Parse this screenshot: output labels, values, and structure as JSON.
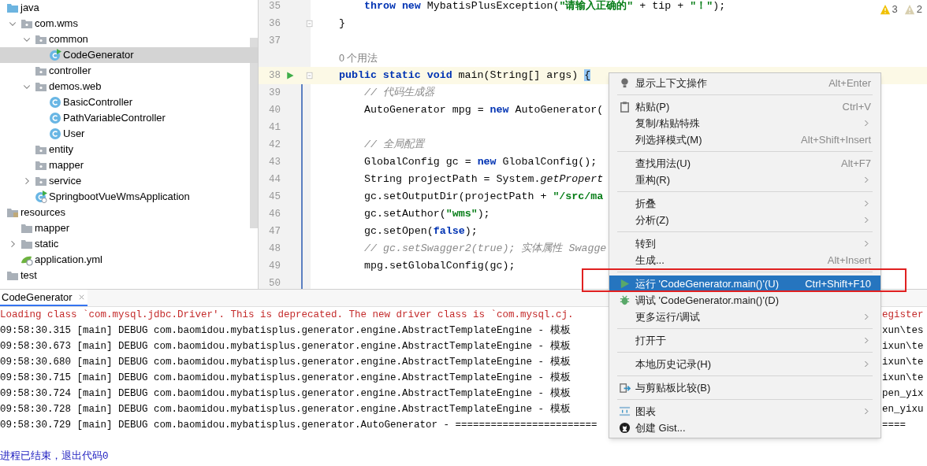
{
  "project_tree": [
    {
      "label": "java",
      "kind": "source-folder",
      "selected": false,
      "children": [
        {
          "label": "com.wms",
          "kind": "package",
          "expanded": true,
          "selected": false,
          "children": [
            {
              "label": "common",
              "kind": "package",
              "expanded": true,
              "selected": false,
              "children": [
                {
                  "label": "CodeGenerator",
                  "kind": "runnable-class",
                  "selected": true
                }
              ]
            },
            {
              "label": "controller",
              "kind": "package",
              "selected": false
            },
            {
              "label": "demos.web",
              "kind": "package",
              "expanded": true,
              "selected": false,
              "children": [
                {
                  "label": "BasicController",
                  "kind": "class",
                  "selected": false
                },
                {
                  "label": "PathVariableController",
                  "kind": "class",
                  "selected": false
                },
                {
                  "label": "User",
                  "kind": "class",
                  "selected": false
                }
              ]
            },
            {
              "label": "entity",
              "kind": "package",
              "selected": false
            },
            {
              "label": "mapper",
              "kind": "package",
              "selected": false
            },
            {
              "label": "service",
              "kind": "package",
              "expanded": false,
              "selected": false
            },
            {
              "label": "SpringbootVueWmsApplication",
              "kind": "spring-class",
              "selected": false
            }
          ]
        }
      ]
    },
    {
      "label": "resources",
      "kind": "resources-folder",
      "selected": false,
      "children": [
        {
          "label": "mapper",
          "kind": "folder",
          "selected": false
        },
        {
          "label": "static",
          "kind": "folder",
          "expanded": false,
          "selected": false
        },
        {
          "label": "application.yml",
          "kind": "yaml",
          "selected": false
        }
      ]
    },
    {
      "label": "test",
      "kind": "folder",
      "selected": false
    }
  ],
  "editor": {
    "inspections": [
      {
        "kind": "warning",
        "count": "3"
      },
      {
        "kind": "weak-warning",
        "count": "2"
      }
    ],
    "lines": [
      {
        "kind": "statement",
        "number": "35",
        "current": false,
        "run_marker": false,
        "fold": false,
        "tokens": [
          {
            "text": "throw new",
            "kind": "keyword"
          },
          {
            "text": " MybatisPlusException(",
            "kind": "plain"
          },
          {
            "text": "\"请输入正确的\"",
            "kind": "string"
          },
          {
            "text": " + tip + ",
            "kind": "plain"
          },
          {
            "text": "\"！\"",
            "kind": "string"
          },
          {
            "text": ");",
            "kind": "plain"
          }
        ]
      },
      {
        "kind": "member",
        "number": "36",
        "current": false,
        "run_marker": false,
        "fold": true,
        "tokens": [
          {
            "text": "}",
            "kind": "plain"
          }
        ]
      },
      {
        "kind": "blank",
        "number": "37",
        "current": false,
        "run_marker": false,
        "fold": false
      },
      {
        "kind": "inlay",
        "text": "0 个用法"
      },
      {
        "kind": "member",
        "number": "38",
        "current": true,
        "run_marker": true,
        "fold": true,
        "tokens": [
          {
            "text": "public static void",
            "kind": "keyword"
          },
          {
            "text": " main(String[] args) ",
            "kind": "plain"
          },
          {
            "text": "{",
            "kind": "brace-match"
          }
        ]
      },
      {
        "kind": "statement",
        "number": "39",
        "current": false,
        "run_marker": false,
        "fold": false,
        "tokens": [
          {
            "text": "// 代码生成器",
            "kind": "comment"
          }
        ]
      },
      {
        "kind": "statement",
        "number": "40",
        "current": false,
        "run_marker": false,
        "fold": false,
        "tokens": [
          {
            "text": "AutoGenerator mpg = ",
            "kind": "plain"
          },
          {
            "text": "new",
            "kind": "keyword"
          },
          {
            "text": " AutoGenerator(",
            "kind": "plain"
          }
        ]
      },
      {
        "kind": "blank",
        "number": "41",
        "current": false,
        "run_marker": false,
        "fold": false
      },
      {
        "kind": "statement",
        "number": "42",
        "current": false,
        "run_marker": false,
        "fold": false,
        "tokens": [
          {
            "text": "// 全局配置",
            "kind": "comment"
          }
        ]
      },
      {
        "kind": "statement",
        "number": "43",
        "current": false,
        "run_marker": false,
        "fold": false,
        "tokens": [
          {
            "text": "GlobalConfig gc = ",
            "kind": "plain"
          },
          {
            "text": "new",
            "kind": "keyword"
          },
          {
            "text": " GlobalConfig();",
            "kind": "plain"
          }
        ]
      },
      {
        "kind": "statement",
        "number": "44",
        "current": false,
        "run_marker": false,
        "fold": false,
        "tokens": [
          {
            "text": "String projectPath = System.",
            "kind": "plain"
          },
          {
            "text": "getPropert",
            "kind": "static-call"
          }
        ]
      },
      {
        "kind": "statement",
        "number": "45",
        "current": false,
        "run_marker": false,
        "fold": false,
        "tokens": [
          {
            "text": "gc.setOutputDir(projectPath + ",
            "kind": "plain"
          },
          {
            "text": "\"/src/ma",
            "kind": "string"
          }
        ]
      },
      {
        "kind": "statement",
        "number": "46",
        "current": false,
        "run_marker": false,
        "fold": false,
        "tokens": [
          {
            "text": "gc.setAuthor(",
            "kind": "plain"
          },
          {
            "text": "\"wms\"",
            "kind": "string"
          },
          {
            "text": ");",
            "kind": "plain"
          }
        ]
      },
      {
        "kind": "statement",
        "number": "47",
        "current": false,
        "run_marker": false,
        "fold": false,
        "tokens": [
          {
            "text": "gc.setOpen(",
            "kind": "plain"
          },
          {
            "text": "false",
            "kind": "keyword"
          },
          {
            "text": ");",
            "kind": "plain"
          }
        ]
      },
      {
        "kind": "statement",
        "number": "48",
        "current": false,
        "run_marker": false,
        "fold": false,
        "tokens": [
          {
            "text": "// gc.setSwagger2(true); 实体属性 Swagge",
            "kind": "comment"
          }
        ]
      },
      {
        "kind": "statement",
        "number": "49",
        "current": false,
        "run_marker": false,
        "fold": false,
        "tokens": [
          {
            "text": "mpg.setGlobalConfig(gc);",
            "kind": "plain"
          }
        ]
      },
      {
        "kind": "blank",
        "number": "50",
        "current": false,
        "run_marker": false,
        "fold": false
      }
    ]
  },
  "context_menu": {
    "groups": [
      [
        {
          "label": "显示上下文操作",
          "kind": "bulb",
          "shortcut": "Alt+Enter",
          "submenu": false,
          "selected": false
        }
      ],
      [
        {
          "label": "粘贴(P)",
          "kind": "clipboard",
          "shortcut": "Ctrl+V",
          "submenu": false,
          "selected": false
        },
        {
          "label": "复制/粘贴特殊",
          "kind": "plain",
          "submenu": true,
          "selected": false
        },
        {
          "label": "列选择模式(M)",
          "kind": "plain",
          "shortcut": "Alt+Shift+Insert",
          "submenu": false,
          "selected": false
        }
      ],
      [
        {
          "label": "查找用法(U)",
          "kind": "plain",
          "shortcut": "Alt+F7",
          "submenu": false,
          "selected": false
        },
        {
          "label": "重构(R)",
          "kind": "plain",
          "submenu": true,
          "selected": false
        }
      ],
      [
        {
          "label": "折叠",
          "kind": "plain",
          "submenu": true,
          "selected": false
        },
        {
          "label": "分析(Z)",
          "kind": "plain",
          "submenu": true,
          "selected": false
        }
      ],
      [
        {
          "label": "转到",
          "kind": "plain",
          "submenu": true,
          "selected": false
        },
        {
          "label": "生成...",
          "kind": "plain",
          "shortcut": "Alt+Insert",
          "submenu": false,
          "selected": false
        }
      ],
      [
        {
          "label": "运行 'CodeGenerator.main()'(U)",
          "kind": "run",
          "shortcut": "Ctrl+Shift+F10",
          "submenu": false,
          "selected": true
        },
        {
          "label": "调试 'CodeGenerator.main()'(D)",
          "kind": "debug",
          "submenu": false,
          "selected": false
        },
        {
          "label": "更多运行/调试",
          "kind": "plain",
          "submenu": true,
          "selected": false
        }
      ],
      [
        {
          "label": "打开于",
          "kind": "plain",
          "submenu": true,
          "selected": false
        }
      ],
      [
        {
          "label": "本地历史记录(H)",
          "kind": "plain",
          "submenu": true,
          "selected": false
        }
      ],
      [
        {
          "label": "与剪贴板比较(B)",
          "kind": "compare",
          "submenu": false,
          "selected": false
        }
      ],
      [
        {
          "label": "图表",
          "kind": "diagram",
          "submenu": true,
          "selected": false
        },
        {
          "label": "创建 Gist...",
          "kind": "github",
          "submenu": false,
          "selected": false
        }
      ]
    ]
  },
  "run_panel": {
    "tabs": [
      {
        "label": "CodeGenerator",
        "selected": true
      }
    ],
    "lines": [
      {
        "kind": "error",
        "text": "Loading class `com.mysql.jdbc.Driver'. This is deprecated. The new driver class is `com.mysql.cj.",
        "tail": "egister"
      },
      {
        "kind": "log",
        "text": "09:58:30.315 [main] DEBUG com.baomidou.mybatisplus.generator.engine.AbstractTemplateEngine - 模板",
        "tail": "xun\\tes"
      },
      {
        "kind": "log",
        "text": "09:58:30.673 [main] DEBUG com.baomidou.mybatisplus.generator.engine.AbstractTemplateEngine - 模板",
        "tail": "ixun\\te"
      },
      {
        "kind": "log",
        "text": "09:58:30.680 [main] DEBUG com.baomidou.mybatisplus.generator.engine.AbstractTemplateEngine - 模板",
        "tail": "ixun\\te"
      },
      {
        "kind": "log",
        "text": "09:58:30.715 [main] DEBUG com.baomidou.mybatisplus.generator.engine.AbstractTemplateEngine - 模板",
        "tail": "ixun\\te"
      },
      {
        "kind": "log",
        "text": "09:58:30.724 [main] DEBUG com.baomidou.mybatisplus.generator.engine.AbstractTemplateEngine - 模板",
        "tail": "pen_yix"
      },
      {
        "kind": "log",
        "text": "09:58:30.728 [main] DEBUG com.baomidou.mybatisplus.generator.engine.AbstractTemplateEngine - 模板",
        "tail": "en_yixu"
      },
      {
        "kind": "log",
        "text": "09:58:30.729 [main] DEBUG com.baomidou.mybatisplus.generator.AutoGenerator - ========================",
        "tail": "===="
      },
      {
        "kind": "blank"
      },
      {
        "kind": "exit",
        "text": "进程已结束，退出代码0"
      }
    ]
  }
}
